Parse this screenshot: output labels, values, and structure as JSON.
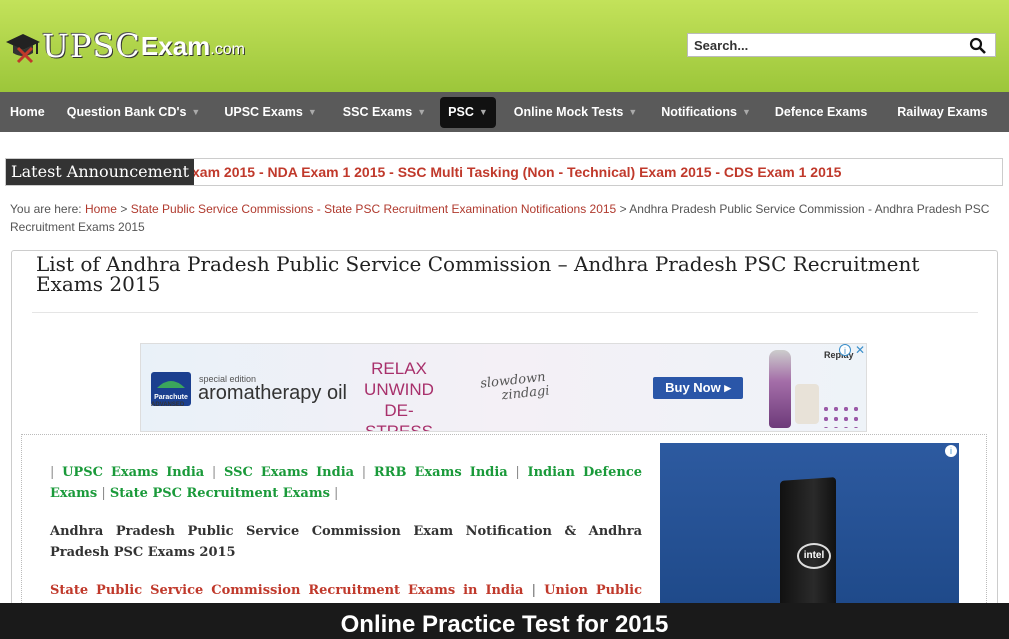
{
  "header": {
    "logo_upsc": "UPSC",
    "logo_exam": "Exam",
    "logo_com": ".com",
    "search_placeholder": "Search..."
  },
  "nav": {
    "items": [
      {
        "label": "Home",
        "has_caret": false
      },
      {
        "label": "Question Bank CD's",
        "has_caret": true
      },
      {
        "label": "UPSC Exams",
        "has_caret": true
      },
      {
        "label": "SSC Exams",
        "has_caret": true
      },
      {
        "label": "PSC",
        "has_caret": true,
        "active": true
      },
      {
        "label": "Online Mock Tests",
        "has_caret": true
      },
      {
        "label": "Notifications",
        "has_caret": true
      },
      {
        "label": "Defence Exams",
        "has_caret": false
      },
      {
        "label": "Railway Exams",
        "has_caret": false
      }
    ],
    "caret": "▼"
  },
  "announcement": {
    "label": "Latest Announcement",
    "text": "xam 2015 - NDA Exam 1 2015 - SSC Multi Tasking (Non - Technical) Exam 2015 - CDS Exam 1 2015"
  },
  "breadcrumb": {
    "prefix": "You are here:",
    "home": "Home",
    "sep": ">",
    "link2": "State Public Service Commissions - State PSC Recruitment Examination Notifications 2015",
    "current": "Andhra Pradesh Public Service Commission - Andhra Pradesh PSC Recruitment Exams 2015"
  },
  "page": {
    "title": "List of Andhra Pradesh Public Service Commission – Andhra Pradesh PSC Recruitment Exams 2015"
  },
  "banner_ad": {
    "brand": "Parachute",
    "brand_sub": "ADVANSED",
    "special": "special edition",
    "product": "aromatherapy oil",
    "line1": "RELAX",
    "line2": "UNWIND",
    "line3": "DE-STRESS",
    "script1": "slowdown",
    "script2": "zindagi",
    "cta": "Buy Now ▸",
    "replay": "Replay",
    "info": "i",
    "close": "✕"
  },
  "content": {
    "sep": "|",
    "links": [
      "UPSC Exams India",
      "SSC Exams India",
      "RRB Exams India",
      "Indian Defence Exams",
      "State PSC Recruitment Exams"
    ],
    "paragraph": "Andhra Pradesh Public Service Commission Exam Notification & Andhra Pradesh PSC Exams 2015",
    "red_link1": "State Public Service Commission Recruitment Exams in India",
    "red_link2": "Union Public Service Commission"
  },
  "side_ad": {
    "info": "i",
    "logo": "intel"
  },
  "bottom_bar": {
    "text": "Online Practice Test for 2015"
  },
  "colors": {
    "header_green": "#9cc63a",
    "nav_bg": "#5a5a5a",
    "announce_red": "#c0392b",
    "link_green": "#1a9a3a"
  }
}
